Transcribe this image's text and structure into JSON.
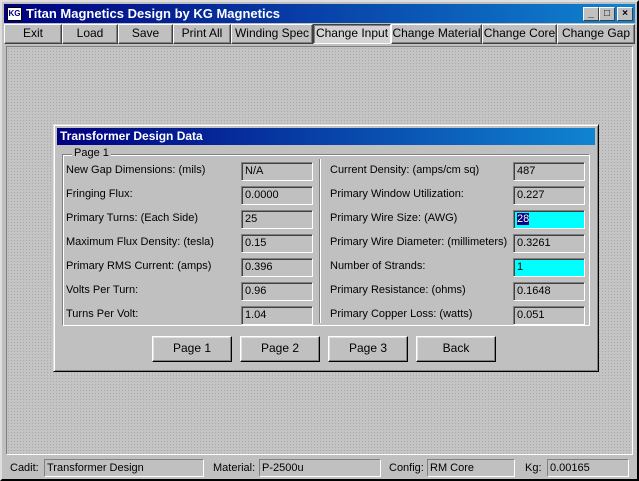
{
  "window": {
    "title": "Titan Magnetics Design by KG Magnetics",
    "icon_text": "KG",
    "minimize_glyph": "_",
    "maximize_glyph": "□",
    "close_glyph": "×"
  },
  "toolbar": {
    "exit": "Exit",
    "load": "Load",
    "save": "Save",
    "print_all": "Print All",
    "winding_spec": "Winding Spec",
    "change_input": "Change Input",
    "change_material": "Change Material",
    "change_core": "Change Core",
    "change_gap": "Change Gap"
  },
  "dialog": {
    "title": "Transformer Design Data",
    "group_label": "Page 1",
    "left": [
      {
        "label": "New Gap Dimensions: (mils)",
        "value": "N/A"
      },
      {
        "label": "Fringing Flux:",
        "value": "0.0000"
      },
      {
        "label": "Primary Turns: (Each Side)",
        "value": "25"
      },
      {
        "label": "Maximum Flux Density: (tesla)",
        "value": "0.15"
      },
      {
        "label": "Primary RMS Current: (amps)",
        "value": "0.396"
      },
      {
        "label": "Volts Per Turn:",
        "value": "0.96"
      },
      {
        "label": "Turns Per Volt:",
        "value": "1.04"
      }
    ],
    "right": [
      {
        "label": "Current Density: (amps/cm sq)",
        "value": "487"
      },
      {
        "label": "Primary Window Utilization:",
        "value": "0.227"
      },
      {
        "label": "Primary Wire Size: (AWG)",
        "value": "28"
      },
      {
        "label": "Primary Wire Diameter: (millimeters)",
        "value": "0.3261"
      },
      {
        "label": "Number of Strands:",
        "value": "1"
      },
      {
        "label": "Primary Resistance: (ohms)",
        "value": "0.1648"
      },
      {
        "label": "Primary Copper Loss: (watts)",
        "value": "0.051"
      }
    ],
    "buttons": {
      "page1": "Page 1",
      "page2": "Page 2",
      "page3": "Page 3",
      "back": "Back"
    }
  },
  "status": {
    "cadit_label": "Cadit:",
    "cadit_value": "Transformer Design",
    "material_label": "Material:",
    "material_value": "P-2500u",
    "config_label": "Config:",
    "config_value": "RM Core",
    "kg_label": "Kg:",
    "kg_value": "0.00165"
  },
  "colors": {
    "titlebar": "#000080",
    "editable_field": "#00ffff",
    "selection": "#000080"
  }
}
